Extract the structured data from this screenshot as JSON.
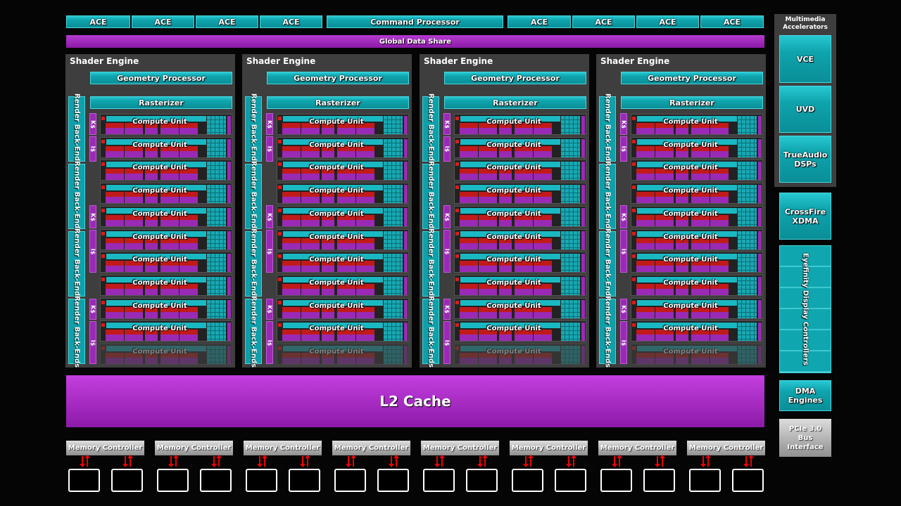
{
  "top_bar": {
    "aces_left": [
      "ACE",
      "ACE",
      "ACE",
      "ACE"
    ],
    "command_processor": "Command Processor",
    "aces_right": [
      "ACE",
      "ACE",
      "ACE",
      "ACE"
    ]
  },
  "global_data_share": "Global Data Share",
  "shader_engine": {
    "title": "Shader Engine",
    "geometry_processor": "Geometry Processor",
    "rasterizer": "Rasterizer",
    "render_back_ends": "Render Back-Ends",
    "k_cache": "K$",
    "i_cache": "I$",
    "compute_unit": "Compute Unit",
    "engine_count": 4,
    "compute_units_per_engine": 11,
    "disabled_compute_units_per_engine": 1
  },
  "l2_cache": "L2 Cache",
  "memory_controller": "Memory Controller",
  "memory_controller_count": 8,
  "side": {
    "multimedia_title": "Multimedia Accelerators",
    "vce": "VCE",
    "uvd": "UVD",
    "trueaudio": "TrueAudio DSPs",
    "crossfire": "CrossFire XDMA",
    "eyefinity": "Eyefinity Display Controllers",
    "dma": "DMA Engines",
    "pcie": "PCIe 3.0 Bus Interface"
  },
  "colors": {
    "teal": "#0fa4ad",
    "purple": "#9a2ab5",
    "red": "#e01818",
    "panel": "#3e3e3e"
  }
}
